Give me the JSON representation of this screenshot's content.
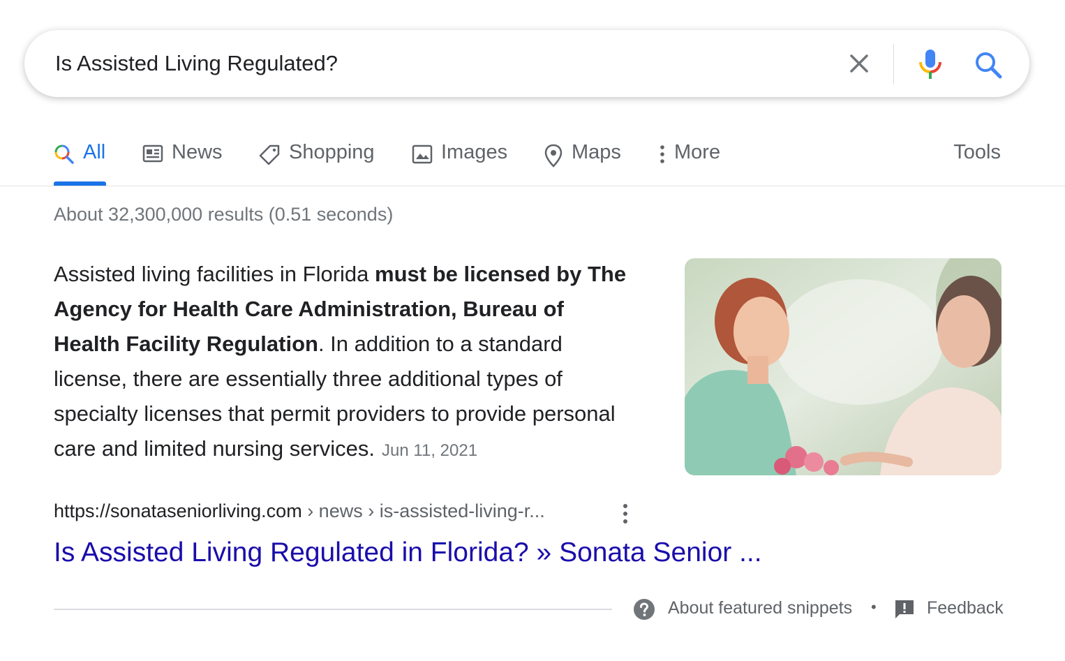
{
  "search": {
    "query": "Is Assisted Living Regulated?",
    "icons": [
      "close-icon",
      "mic-icon",
      "search-icon"
    ]
  },
  "tabs": [
    {
      "label": "All",
      "icon": "search-icon",
      "active": true
    },
    {
      "label": "News",
      "icon": "news-icon"
    },
    {
      "label": "Shopping",
      "icon": "tag-icon"
    },
    {
      "label": "Images",
      "icon": "image-icon"
    },
    {
      "label": "Maps",
      "icon": "map-pin-icon"
    },
    {
      "label": "More",
      "icon": "more-vertical-icon"
    }
  ],
  "tools_label": "Tools",
  "result_stats": "About 32,300,000 results (0.51 seconds)",
  "snippet": {
    "text_1": "Assisted living facilities in Florida ",
    "bold_1": "must be licensed by The Agency for Health Care Administration, Bureau of Health Facility Regulation",
    "text_2": ". In addition to a standard license, there are essentially three additional types of specialty licenses that permit providers to provide personal care and limited nursing services.",
    "date": "Jun 11, 2021"
  },
  "result": {
    "domain": "https://sonataseniorliving.com",
    "path": " › news › is-assisted-living-r...",
    "title": "Is Assisted Living Regulated in Florida? » Sonata Senior ..."
  },
  "footer": {
    "about_label": "About featured snippets",
    "separator": "•",
    "feedback_label": "Feedback"
  },
  "colors": {
    "link": "#1a0dab",
    "accent": "#1a73e8",
    "secondary_text": "#5f6368"
  }
}
